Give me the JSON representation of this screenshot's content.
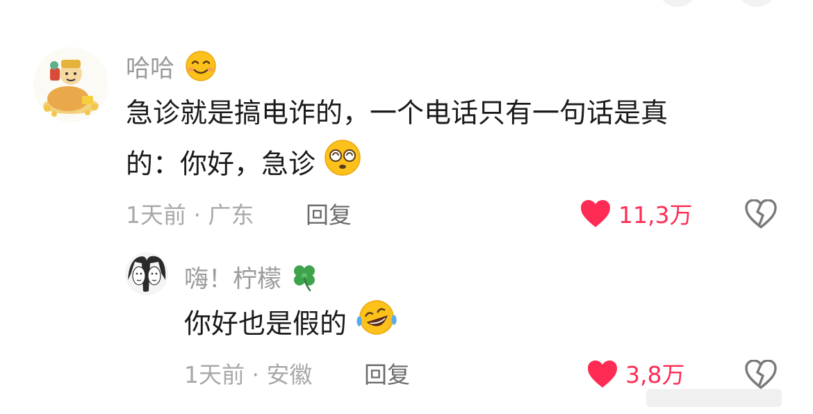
{
  "comment": {
    "username": "哈哈",
    "text_line1": "急诊就是搞电诈的，一个电话只有一句话是真",
    "text_line2": "的：你好，急诊",
    "time_location": "1天前 · 广东",
    "reply_label": "回复",
    "like_count": "11,3万"
  },
  "reply": {
    "username": "嗨！柠檬",
    "text": "你好也是假的",
    "time_location": "1天前 · 安徽",
    "reply_label": "回复",
    "like_count": "3,8万"
  },
  "colors": {
    "like": "#fe2c55",
    "meta": "#a8a8a8",
    "text": "#1a1a1a"
  },
  "icons": [
    "heart-icon",
    "broken-heart-icon",
    "smile-emoji",
    "dazed-emoji",
    "clover-emoji",
    "laughing-crying-emoji"
  ]
}
